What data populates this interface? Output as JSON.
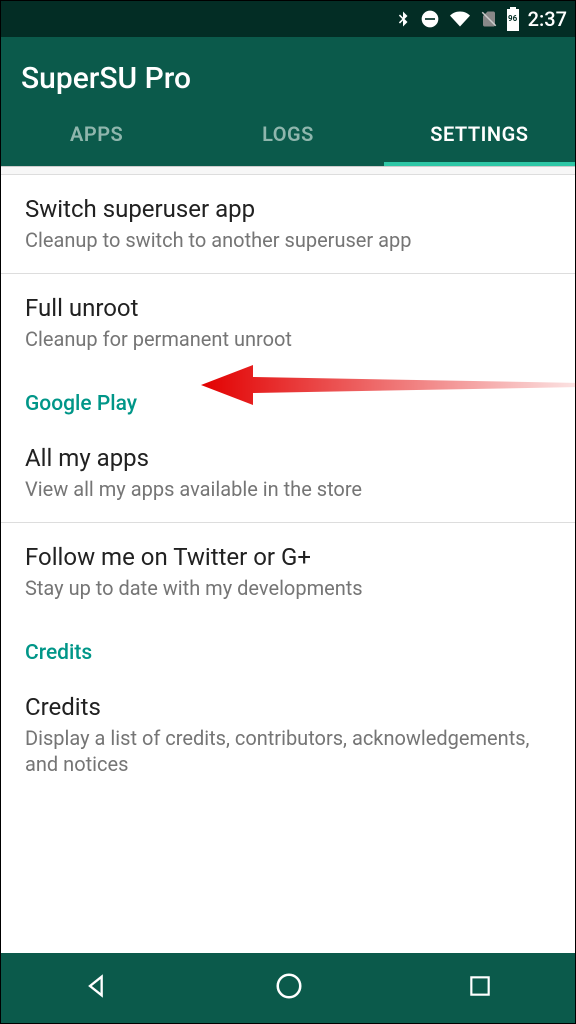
{
  "status": {
    "time": "2:37",
    "battery": "96"
  },
  "app": {
    "title": "SuperSU Pro"
  },
  "tabs": {
    "apps": "APPS",
    "logs": "LOGS",
    "settings": "SETTINGS"
  },
  "items": {
    "switch": {
      "title": "Switch superuser app",
      "sub": "Cleanup to switch to another superuser app"
    },
    "unroot": {
      "title": "Full unroot",
      "sub": "Cleanup for permanent unroot"
    },
    "gplay_header": "Google Play",
    "allapps": {
      "title": "All my apps",
      "sub": "View all my apps available in the store"
    },
    "follow": {
      "title": "Follow me on Twitter or G+",
      "sub": "Stay up to date with my developments"
    },
    "credits_header": "Credits",
    "credits": {
      "title": "Credits",
      "sub": "Display a list of credits, contributors, acknowledgements, and notices"
    }
  }
}
